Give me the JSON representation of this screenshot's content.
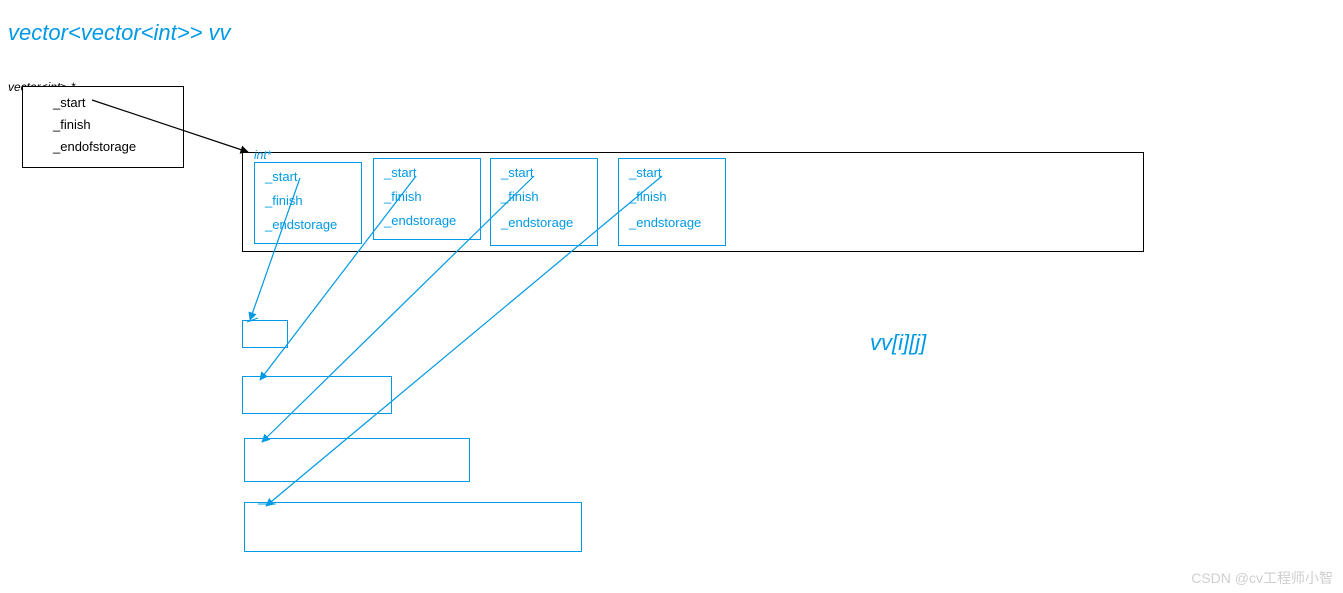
{
  "title": "vector<vector<int>> vv",
  "outer": {
    "type_label": "vector<int> *",
    "fields": [
      "_start",
      "_finish",
      "_endofstorage"
    ]
  },
  "container": {
    "type_label": "int*",
    "items": [
      {
        "fields": [
          "_start",
          "_finish",
          "_endstorage"
        ]
      },
      {
        "fields": [
          "_start",
          "_finish",
          "_endstorage"
        ]
      },
      {
        "fields": [
          "_start",
          "_finish",
          "_endstorage"
        ]
      },
      {
        "fields": [
          "_start",
          "_finish",
          "_endstorage"
        ]
      }
    ]
  },
  "access_expr": "vv[i][j]",
  "watermark": "CSDN @cv工程师小智"
}
